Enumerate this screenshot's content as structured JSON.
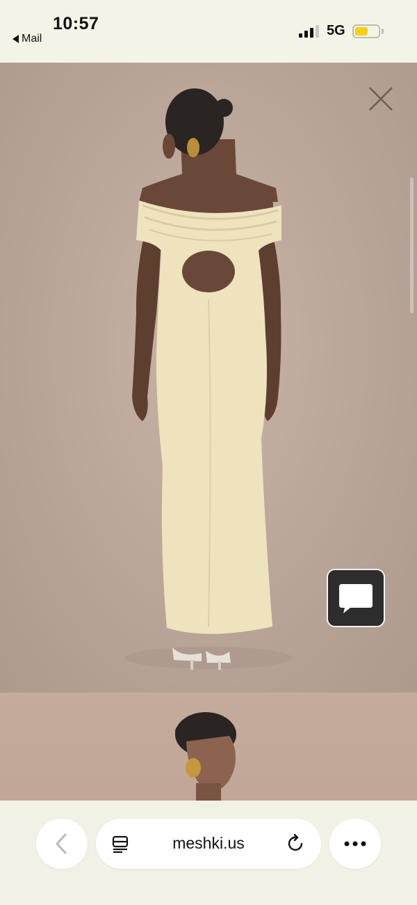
{
  "status_bar": {
    "time": "10:57",
    "back_app": "Mail",
    "network": "5G",
    "battery_level": 0.55,
    "battery_color": "#f4d016"
  },
  "product_images": [
    {
      "icon": "product-photo-dress-back"
    },
    {
      "icon": "product-photo-model-portrait"
    }
  ],
  "overlay": {
    "close_icon": "close-icon",
    "chat_icon": "chat-bubble-icon"
  },
  "browser_toolbar": {
    "url": "meshki.us",
    "back_icon": "chevron-left-icon",
    "reader_icon": "reader-mode-icon",
    "reload_icon": "reload-icon",
    "more_icon": "more-icon"
  },
  "colors": {
    "background": "#f2f1e6",
    "dress": "#efe3bd",
    "photo_backdrop": "#bca89a"
  }
}
